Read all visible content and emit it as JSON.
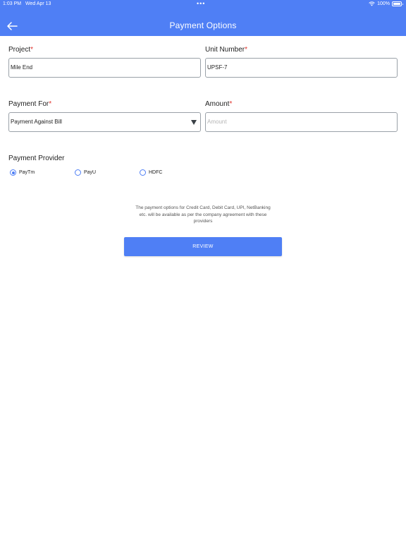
{
  "status_bar": {
    "time": "1:03 PM",
    "date": "Wed Apr 13",
    "dots": "•••",
    "battery": "100%"
  },
  "header": {
    "title": "Payment Options",
    "back_icon": "arrow-left-icon",
    "background_color": "#4f7ff5"
  },
  "form": {
    "project": {
      "label": "Project",
      "required_mark": "*",
      "value": "Mile End"
    },
    "unit_number": {
      "label": "Unit Number",
      "required_mark": "*",
      "value": "UPSF-7"
    },
    "payment_for": {
      "label": "Payment For",
      "required_mark": "*",
      "value": "Payment Against Bill"
    },
    "amount": {
      "label": "Amount",
      "required_mark": "*",
      "value": "",
      "placeholder": "Amount"
    }
  },
  "payment_provider": {
    "label": "Payment Provider",
    "options": [
      {
        "label": "PayTm",
        "selected": true
      },
      {
        "label": "PayU",
        "selected": false
      },
      {
        "label": "HDFC",
        "selected": false
      }
    ]
  },
  "info_text": "The payment options for Credit Card, Debit Card, UPI, NetBanking etc. will be available as per the company agreement with these providers",
  "review_button": {
    "label": "REVIEW"
  }
}
